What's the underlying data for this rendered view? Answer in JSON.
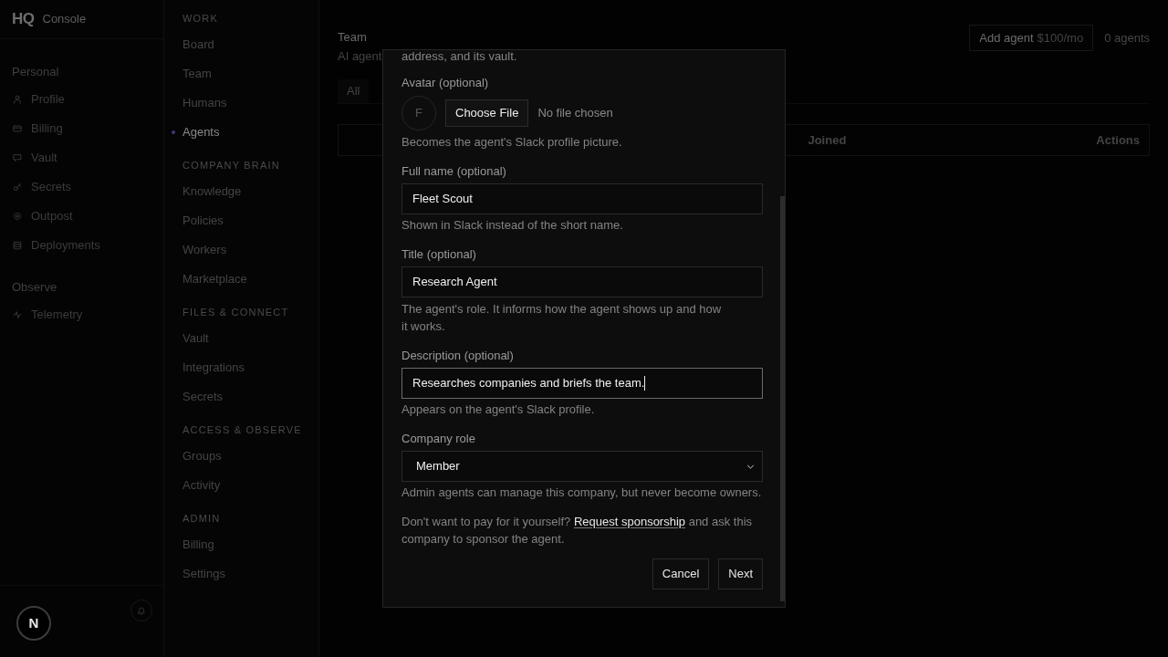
{
  "sidebar": {
    "logo": "HQ",
    "title": "Console",
    "sections": [
      {
        "heading": "Personal",
        "items": [
          "Profile",
          "Billing",
          "Vault",
          "Secrets",
          "Outpost",
          "Deployments"
        ]
      },
      {
        "heading": "Observe",
        "items": [
          "Telemetry"
        ]
      }
    ]
  },
  "dev_badge": {
    "label": "N"
  },
  "nav": {
    "sections": [
      {
        "heading": "WORK",
        "items": [
          {
            "label": "Board",
            "selected": false
          },
          {
            "label": "Team",
            "selected": false
          },
          {
            "label": "Humans",
            "selected": false
          },
          {
            "label": "Agents",
            "selected": true
          }
        ]
      },
      {
        "heading": "COMPANY BRAIN",
        "items": [
          {
            "label": "Knowledge",
            "selected": false
          },
          {
            "label": "Policies",
            "selected": false
          },
          {
            "label": "Workers",
            "selected": false
          },
          {
            "label": "Marketplace",
            "selected": false
          }
        ]
      },
      {
        "heading": "FILES & CONNECT",
        "items": [
          {
            "label": "Vault",
            "selected": false
          },
          {
            "label": "Integrations",
            "selected": false
          },
          {
            "label": "Secrets",
            "selected": false
          }
        ]
      },
      {
        "heading": "ACCESS & OBSERVE",
        "items": [
          {
            "label": "Groups",
            "selected": false
          },
          {
            "label": "Activity",
            "selected": false
          }
        ]
      },
      {
        "heading": "ADMIN",
        "items": [
          {
            "label": "Billing",
            "selected": false
          },
          {
            "label": "Settings",
            "selected": false
          }
        ]
      }
    ]
  },
  "page": {
    "title": "Team",
    "subtitle": "AI agent",
    "add_button": {
      "label": "Add agent",
      "price": "$100/mo"
    },
    "count": "0 agents",
    "tabs": [
      {
        "label": "All",
        "selected": true
      }
    ],
    "table": {
      "columns": [
        "Joined",
        "Actions"
      ]
    }
  },
  "dialog": {
    "intro_tail": "address, and its vault.",
    "avatar": {
      "label": "Avatar (optional)",
      "initial": "F",
      "button": "Choose File",
      "file_status": "No file chosen",
      "hint": "Becomes the agent's Slack profile picture."
    },
    "fields": [
      {
        "kind": "text",
        "label": "Full name (optional)",
        "value": "Fleet Scout",
        "focused": false,
        "hint": "Shown in Slack instead of the short name."
      },
      {
        "kind": "text",
        "label": "Title (optional)",
        "value": "Research Agent",
        "focused": false,
        "hint": "The agent's role. It informs how the agent shows up and how it works."
      },
      {
        "kind": "text",
        "label": "Description (optional)",
        "value": "Researches companies and briefs the team.",
        "focused": true,
        "hint": "Appears on the agent's Slack profile."
      },
      {
        "kind": "select",
        "label": "Company role",
        "value": "Member",
        "focused": false,
        "hint": "Admin agents can manage this company, but never become owners."
      }
    ],
    "sponsorship": {
      "before": "Don't want to pay for it yourself?",
      "link": "Request sponsorship",
      "after": "and ask this company to sponsor the agent."
    },
    "buttons": [
      "Cancel",
      "Next"
    ]
  }
}
